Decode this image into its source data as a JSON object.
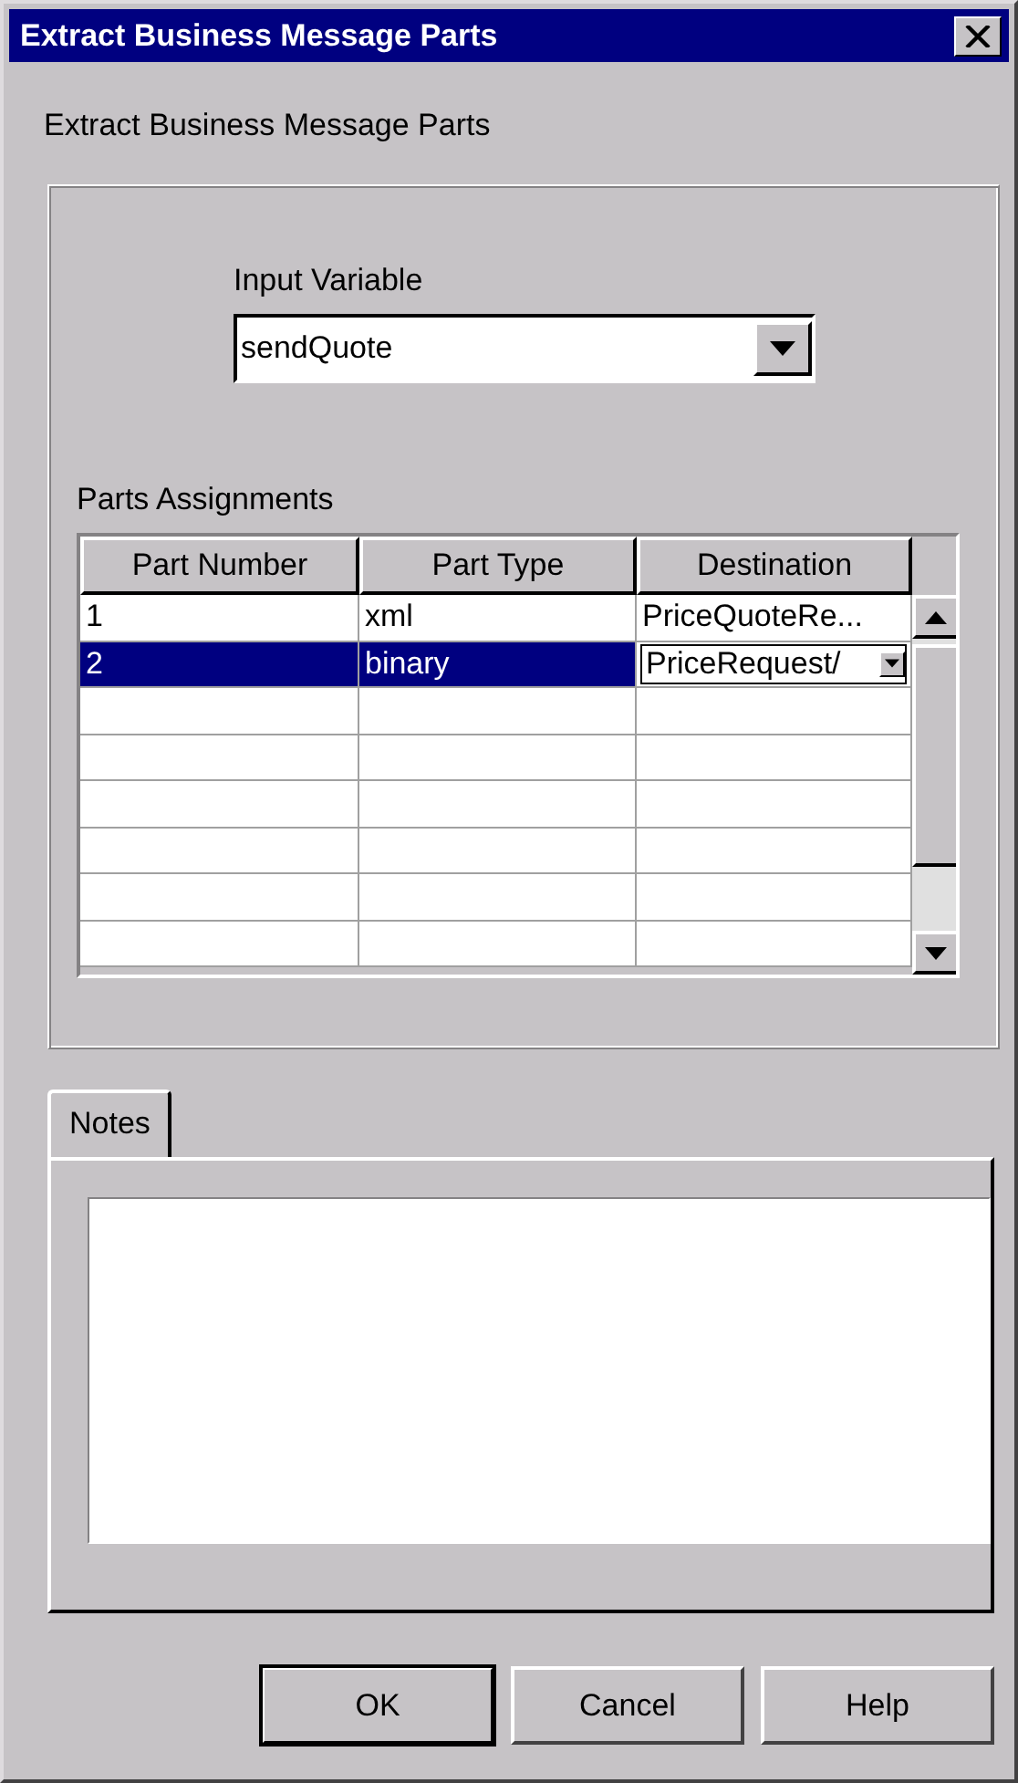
{
  "window": {
    "title": "Extract Business Message Parts"
  },
  "heading": "Extract Business Message Parts",
  "input_variable": {
    "label": "Input Variable",
    "value": "sendQuote"
  },
  "parts_assignments": {
    "label": "Parts Assignments",
    "columns": [
      "Part Number",
      "Part Type",
      "Destination"
    ],
    "rows": [
      {
        "cells": [
          "1",
          "xml",
          "PriceQuoteRe..."
        ],
        "selected": false,
        "editing": false
      },
      {
        "cells": [
          "2",
          "binary",
          "PriceRequest/"
        ],
        "selected": true,
        "editing": true
      }
    ]
  },
  "notes": {
    "tab": "Notes"
  },
  "buttons": [
    {
      "label": "OK",
      "default": true
    },
    {
      "label": "Cancel",
      "default": false
    },
    {
      "label": "Help",
      "default": false
    }
  ]
}
